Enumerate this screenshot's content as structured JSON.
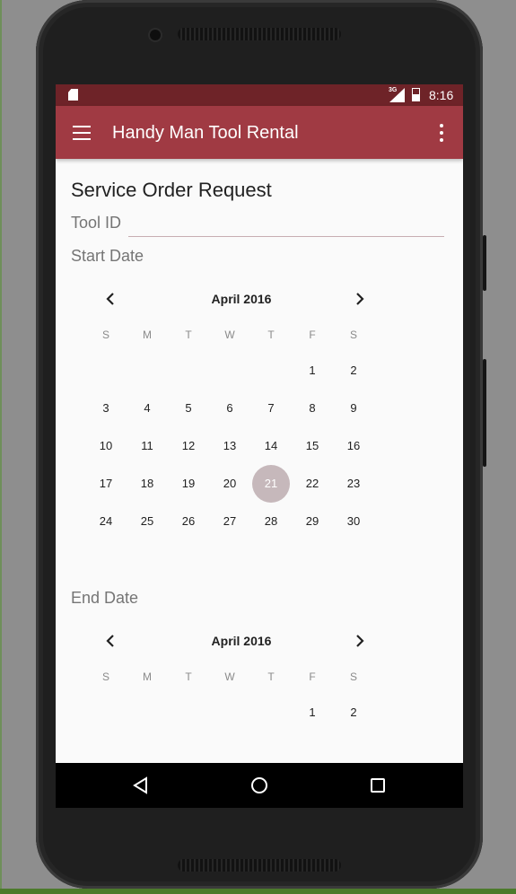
{
  "status_bar": {
    "time": "8:16",
    "network": "3G"
  },
  "app_bar": {
    "title": "Handy Man Tool Rental"
  },
  "form": {
    "heading": "Service Order Request",
    "tool_id_label": "Tool ID",
    "tool_id_value": "",
    "start_date_label": "Start Date",
    "end_date_label": "End Date"
  },
  "start_calendar": {
    "month": "April 2016",
    "weekdays": [
      "S",
      "M",
      "T",
      "W",
      "T",
      "F",
      "S"
    ],
    "first_weekday_index": 5,
    "days": [
      "1",
      "2",
      "3",
      "4",
      "5",
      "6",
      "7",
      "8",
      "9",
      "10",
      "11",
      "12",
      "13",
      "14",
      "15",
      "16",
      "17",
      "18",
      "19",
      "20",
      "21",
      "22",
      "23",
      "24",
      "25",
      "26",
      "27",
      "28",
      "29",
      "30"
    ],
    "selected_day": "21"
  },
  "end_calendar": {
    "month": "April 2016",
    "weekdays": [
      "S",
      "M",
      "T",
      "W",
      "T",
      "F",
      "S"
    ],
    "first_weekday_index": 5,
    "days": [
      "1",
      "2"
    ]
  },
  "colors": {
    "status_bar": "#6e2328",
    "app_bar": "#a03a43",
    "selected_day": "#c6b8bb",
    "nav_bar": "#000000"
  }
}
